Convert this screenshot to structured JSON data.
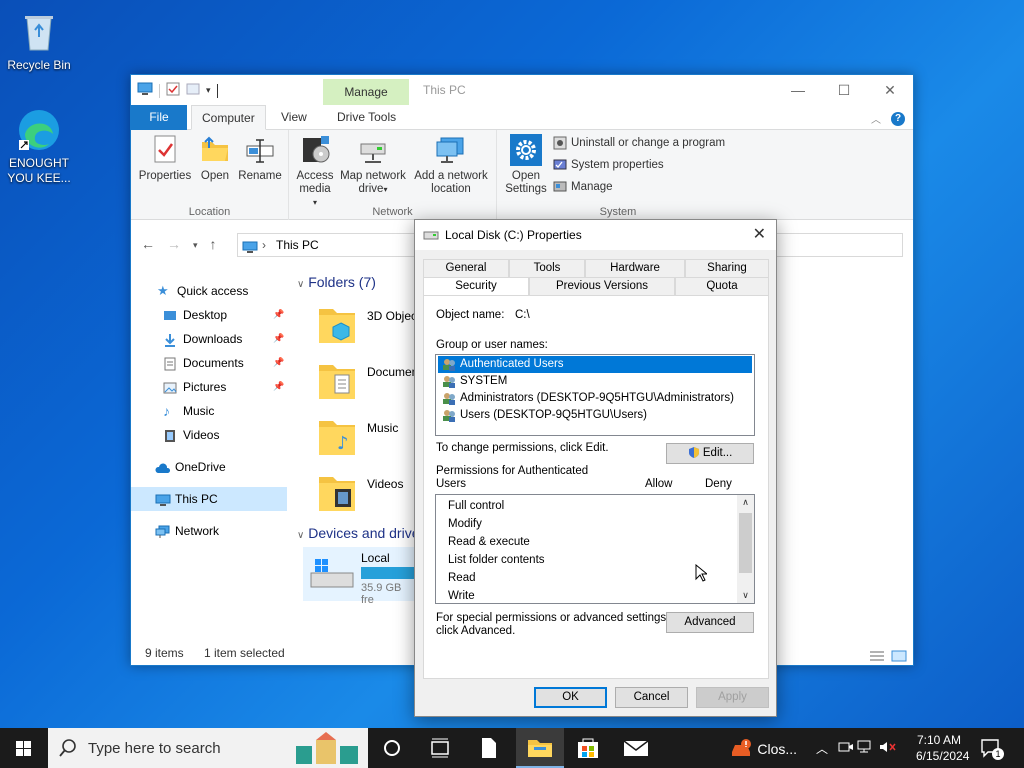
{
  "desktop": {
    "icons": [
      {
        "label": "Recycle Bin"
      },
      {
        "label": "ENOUGHT YOU KEE..."
      }
    ]
  },
  "explorer": {
    "title": "This PC",
    "manage_tab": "Manage",
    "tabs": {
      "file": "File",
      "computer": "Computer",
      "view": "View",
      "drive_tools": "Drive Tools"
    },
    "ribbon": {
      "location": {
        "label": "Location",
        "buttons": [
          "Properties",
          "Open",
          "Rename"
        ]
      },
      "network": {
        "label": "Network",
        "access_media": "Access media",
        "map_drive": "Map network drive",
        "add_location": "Add a network location"
      },
      "system": {
        "label": "System",
        "open_settings": "Open Settings",
        "uninstall": "Uninstall or change a program",
        "system_properties": "System properties",
        "manage": "Manage"
      }
    },
    "address": "This PC",
    "nav": {
      "quick_access": "Quick access",
      "items": [
        "Desktop",
        "Downloads",
        "Documents",
        "Pictures",
        "Music",
        "Videos"
      ],
      "onedrive": "OneDrive",
      "this_pc": "This PC",
      "network": "Network"
    },
    "folders_header": "Folders (7)",
    "folders": [
      "3D Objects",
      "Documents",
      "Music",
      "Videos"
    ],
    "devices_header": "Devices and drives",
    "drive": {
      "name": "Local Disk",
      "free": "35.9 GB fre"
    },
    "status": {
      "items": "9 items",
      "selected": "1 item selected"
    }
  },
  "dialog": {
    "title": "Local Disk (C:) Properties",
    "tabs_row1": [
      "General",
      "Tools",
      "Hardware",
      "Sharing"
    ],
    "tabs_row2": [
      "Security",
      "Previous Versions",
      "Quota"
    ],
    "object_name_label": "Object name:",
    "object_name_value": "C:\\",
    "group_label": "Group or user names:",
    "users": [
      "Authenticated Users",
      "SYSTEM",
      "Administrators (DESKTOP-9Q5HTGU\\Administrators)",
      "Users (DESKTOP-9Q5HTGU\\Users)"
    ],
    "change_text": "To change permissions, click Edit.",
    "edit_button": "Edit...",
    "perm_label_1": "Permissions for Authenticated",
    "perm_label_2": "Users",
    "allow": "Allow",
    "deny": "Deny",
    "permissions": [
      "Full control",
      "Modify",
      "Read & execute",
      "List folder contents",
      "Read",
      "Write"
    ],
    "special_1": "For special permissions or advanced settings,",
    "special_2": "click Advanced.",
    "advanced_button": "Advanced",
    "ok": "OK",
    "cancel": "Cancel",
    "apply": "Apply"
  },
  "taskbar": {
    "search_placeholder": "Type here to search",
    "notification_app": "Clos...",
    "time": "7:10 AM",
    "date": "6/15/2024",
    "notif_count": "1"
  },
  "colors": {
    "accent": "#0078d7",
    "selection": "#cce8ff",
    "taskbar": "#1b1b1b"
  }
}
